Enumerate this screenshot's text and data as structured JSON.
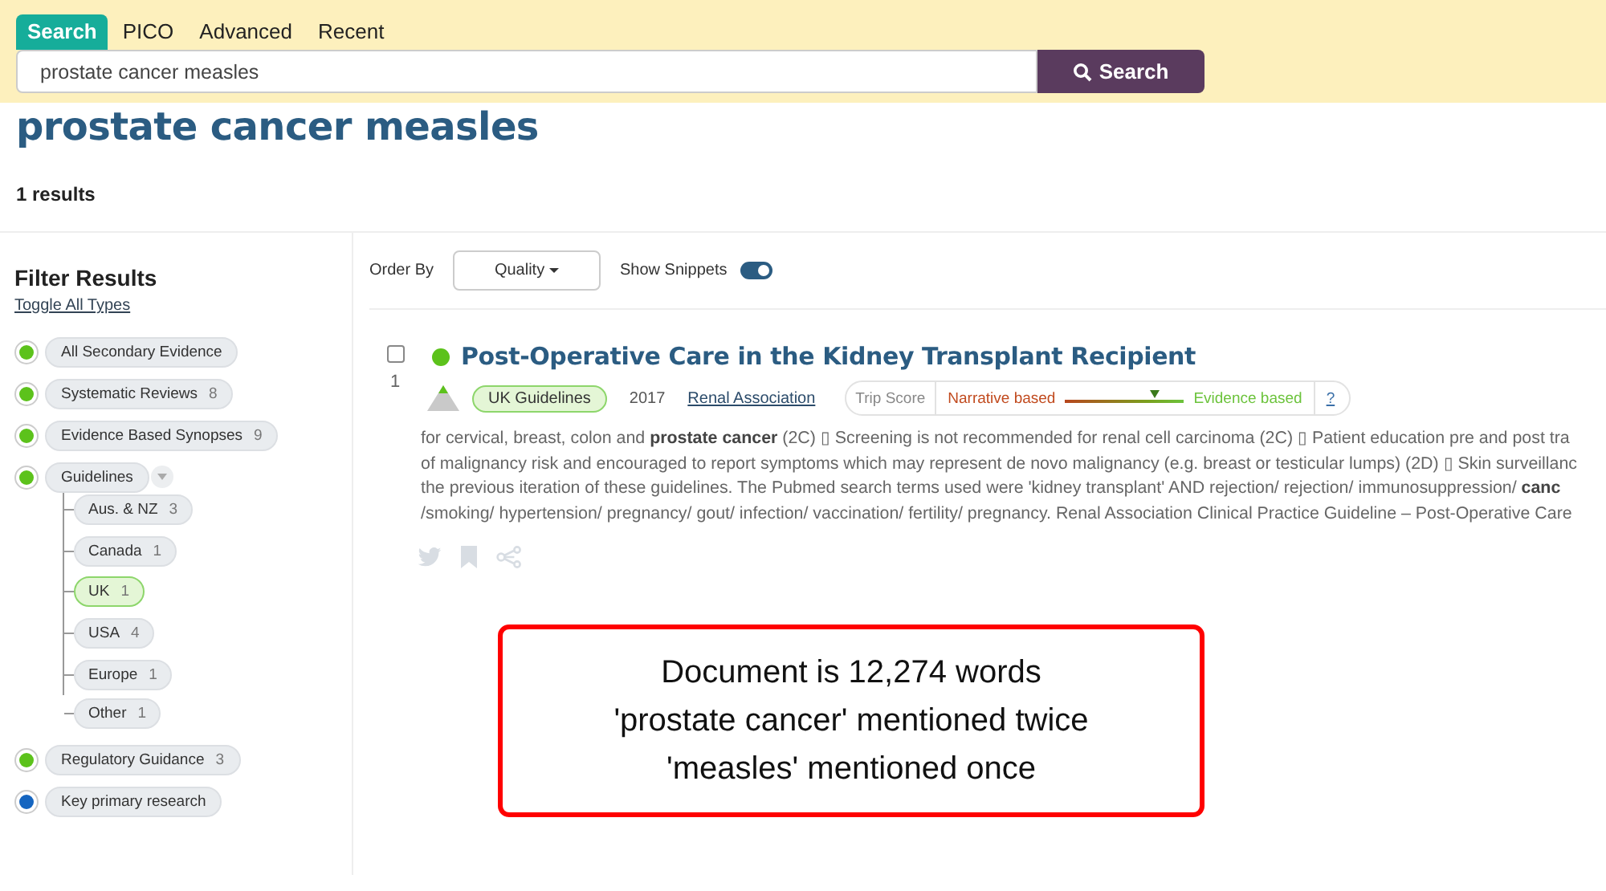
{
  "search_tabs": [
    {
      "label": "Search",
      "selected": true
    },
    {
      "label": "PICO",
      "selected": false
    },
    {
      "label": "Advanced",
      "selected": false
    },
    {
      "label": "Recent",
      "selected": false
    }
  ],
  "search": {
    "value": "prostate cancer measles",
    "button": "Search"
  },
  "heading": "prostate cancer measles",
  "result_count": "1 results",
  "filters": {
    "title": "Filter Results",
    "toggle_link": "Toggle All Types",
    "items": [
      {
        "label": "All Secondary Evidence",
        "color": "#5cc21b",
        "checked": true
      },
      {
        "label": "Systematic Reviews",
        "count": "8",
        "color": "#5cc21b",
        "checked": true
      },
      {
        "label": "Evidence Based Synopses",
        "count": "9",
        "color": "#5cc21b",
        "checked": true
      },
      {
        "label": "Guidelines",
        "color": "#5cc21b",
        "checked": true,
        "expanded": true,
        "children": [
          {
            "label": "Aus. & NZ",
            "count": "3",
            "selected": false
          },
          {
            "label": "Canada",
            "count": "1",
            "selected": false
          },
          {
            "label": "UK",
            "count": "1",
            "selected": true
          },
          {
            "label": "USA",
            "count": "4",
            "selected": false
          },
          {
            "label": "Europe",
            "count": "1",
            "selected": false
          },
          {
            "label": "Other",
            "count": "1",
            "selected": false
          }
        ]
      },
      {
        "label": "Regulatory Guidance",
        "count": "3",
        "color": "#5cc21b",
        "checked": true
      },
      {
        "label": "Key primary research",
        "color": "#1565c0",
        "checked": true
      }
    ]
  },
  "toolbar": {
    "order_label": "Order By",
    "order_value": "Quality",
    "snippets_label": "Show Snippets",
    "snippets_on": true
  },
  "results": [
    {
      "number": "1",
      "checked": false,
      "color": "#5cc21b",
      "title": "Post-Operative Care in the Kidney Transplant Recipient",
      "tag": "UK Guidelines",
      "year": "2017",
      "publisher": "Renal Association",
      "trip_score": {
        "label": "Trip Score",
        "left": "Narrative based",
        "right": "Evidence based",
        "level": 0.76,
        "help": "?"
      },
      "snippet_lines": [
        "for cervical, breast, colon and **prostate   cancer** (2C) ▯ Screening is not recommended for renal cell carcinoma (2C) ▯ Patient education pre and post tra",
        "of malignancy risk and encouraged to report symptoms which may represent de novo malignancy (e.g. breast or testicular lumps) (2D) ▯ Skin surveillanc",
        "the previous iteration of these guidelines. The Pubmed search terms used were 'kidney transplant' AND rejection/ rejection/ immunosuppression/  **canc**",
        "/smoking/ hypertension/ pregnancy/ gout/ infection/ vaccination/ fertility/ pregnancy. Renal Association Clinical Practice Guideline – Post-Operative Care"
      ]
    }
  ],
  "callout": [
    "Document is 12,274 words",
    "'prostate cancer' mentioned twice",
    "'measles' mentioned once"
  ]
}
